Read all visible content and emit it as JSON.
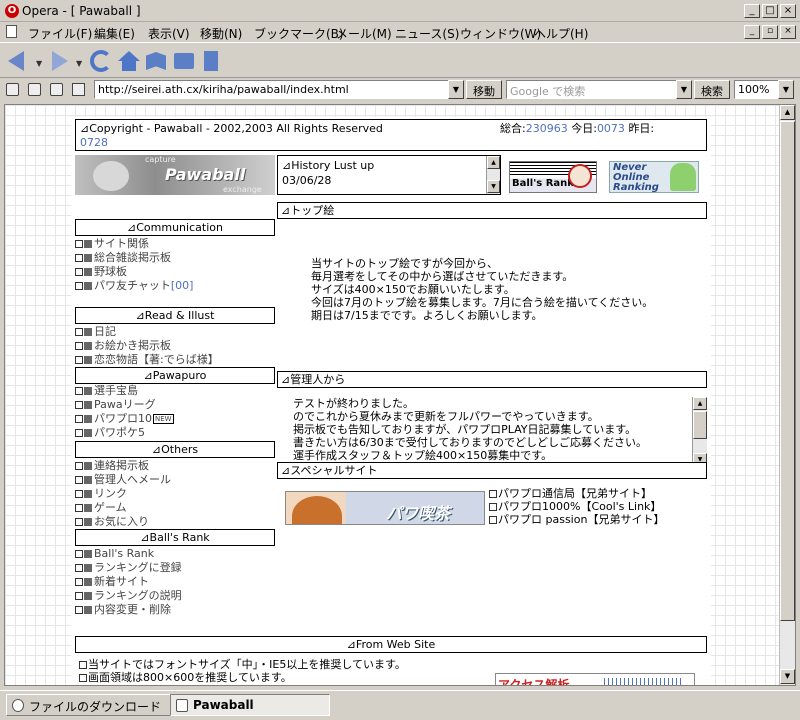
{
  "window": {
    "app_title": "Opera - [ Pawaball ]",
    "controls": [
      "_",
      "□",
      "×"
    ]
  },
  "menu": {
    "items": [
      "ファイル(F)",
      "編集(E)",
      "表示(V)",
      "移動(N)",
      "ブックマーク(B)",
      "メール(M)",
      "ニュース(S)",
      "ウィンドウ(W)",
      "ヘルプ(H)"
    ]
  },
  "nav": {
    "icons": [
      "back-icon",
      "forward-icon",
      "reload-icon",
      "home-icon",
      "bookmarks-icon",
      "print-icon",
      "notes-icon"
    ]
  },
  "address": {
    "url": "http://seirei.ath.cx/kiriha/pawaball/index.html",
    "go_label": "移動",
    "search_placeholder": "Google で検索",
    "search_label": "検索",
    "zoom": "100%"
  },
  "page": {
    "copyright": "⊿Copyright - Pawaball - 2002,2003  All Rights Reserved",
    "counter_total_label": "総合:",
    "counter_total": "230963",
    "counter_today_label": "今日:",
    "counter_today": "0073",
    "counter_yesterday_label": "昨日:",
    "counter_yesterday": "0728",
    "banner_small": "capture",
    "banner_text": "Pawaball",
    "banner_small2": "exchange",
    "history_title": "⊿History      Lust up",
    "history_date": "03/06/28",
    "ballrank_banner": "Ball's Rank",
    "never_banner": [
      "Never",
      "Online",
      "Ranking"
    ],
    "sections": {
      "communication": {
        "title": "⊿Communication",
        "items": [
          "サイト関係",
          "総合雑談掲示板",
          "野球板",
          "パワ友チャット"
        ],
        "chat_count": "[00]"
      },
      "read_illust": {
        "title": "⊿Read & Illust",
        "items": [
          "日記",
          "お絵かき掲示板",
          "恋恋物語【著:でらば様】"
        ]
      },
      "pawapuro": {
        "title": "⊿Pawapuro",
        "items": [
          "選手宝島",
          "Pawaリーグ",
          "パワプロ10",
          "パワポケ5"
        ],
        "new_badge": "NEW"
      },
      "others": {
        "title": "⊿Others",
        "items": [
          "連絡掲示板",
          "管理人へメール",
          "リンク",
          "ゲーム",
          "お気に入り"
        ]
      },
      "ballsrank": {
        "title": "⊿Ball's Rank",
        "items": [
          "Ball's Rank",
          "ランキングに登録",
          "新着サイト",
          "ランキングの説明",
          "内容変更・削除"
        ]
      }
    },
    "top_art": {
      "title": "⊿トップ絵",
      "lines": [
        "当サイトのトップ絵ですが今回から、",
        "毎月選考をしてその中から選ばさせていただきます。",
        "サイズは400×150でお願いいたします。",
        "今回は7月のトップ絵を募集します。7月に合う絵を描いてください。",
        "期日は7/15までです。よろしくお願いします。"
      ]
    },
    "admin": {
      "title": "⊿管理人から",
      "lines": [
        "テストが終わりました。",
        "のでこれから夏休みまで更新をフルパワーでやっていきます。",
        "掲示板でも告知しておりますが、パワプロPLAY日記募集しています。",
        "書きたい方は6/30まで受付しておりますのでどしどしご応募ください。",
        "運手作成スタッフ＆トップ絵400×150募集中です。"
      ]
    },
    "special": {
      "title": "⊿スペシャルサイト",
      "banner_text": "パワ喫茶",
      "links": [
        "パワプロ通信局【兄弟サイト】",
        "パワプロ1000%【Cool's Link】",
        "パワプロ passion【兄弟サイト】"
      ]
    },
    "footer": {
      "title": "⊿From Web Site",
      "lines": [
        "当サイトではフォントサイズ「中」・IE5以上を推奨しています。",
        "画面領域は800×600を推奨しています。"
      ],
      "counter_text": "アクセス解析"
    }
  },
  "status": {
    "tabs": [
      "ファイルのダウンロード",
      "Pawaball"
    ]
  },
  "colors": {
    "link_blue": "#5070c0",
    "opera_red": "#cc0000"
  }
}
